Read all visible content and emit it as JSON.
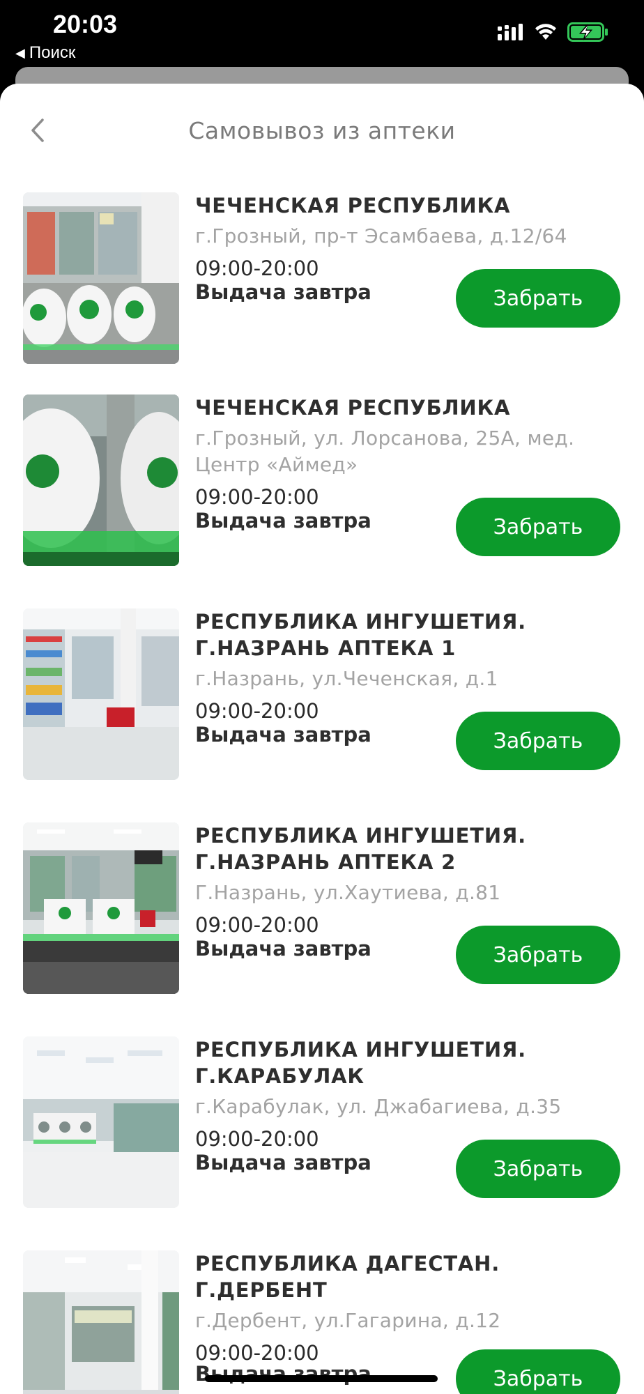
{
  "status_bar": {
    "time": "20:03",
    "back_app": "Поиск",
    "icons": [
      "cellular-signal-icon",
      "wifi-icon",
      "battery-charging-icon"
    ],
    "battery_color": "#34c759"
  },
  "header": {
    "title": "Самовывоз из аптеки",
    "back_icon": "chevron-left-icon"
  },
  "colors": {
    "accent": "#0c9a2b"
  },
  "pharmacies": [
    {
      "name": "ЧЕЧЕНСКАЯ РЕСПУБЛИКА",
      "address": "г.Грозный, пр-т Эсамбаева, д.12/64",
      "hours": "09:00-20:00",
      "delivery": "Выдача завтра",
      "button": "Забрать"
    },
    {
      "name": "ЧЕЧЕНСКАЯ РЕСПУБЛИКА",
      "address": "г.Грозный, ул. Лорсанова, 25А, мед. Центр «Аймед»",
      "hours": "09:00-20:00",
      "delivery": "Выдача завтра",
      "button": "Забрать"
    },
    {
      "name": "РЕСПУБЛИКА ИНГУШЕТИЯ. Г.НАЗРАНЬ АПТЕКА 1",
      "address": "г.Назрань, ул.Чеченская, д.1",
      "hours": "09:00-20:00",
      "delivery": "Выдача завтра",
      "button": "Забрать"
    },
    {
      "name": "РЕСПУБЛИКА ИНГУШЕТИЯ. Г.НАЗРАНЬ АПТЕКА 2",
      "address": "Г.Назрань, ул.Хаутиева, д.81",
      "hours": "09:00-20:00",
      "delivery": "Выдача завтра",
      "button": "Забрать"
    },
    {
      "name": "РЕСПУБЛИКА ИНГУШЕТИЯ. Г.КАРАБУЛАК",
      "address": "г.Карабулак, ул. Джабагиева, д.35",
      "hours": "09:00-20:00",
      "delivery": "Выдача завтра",
      "button": "Забрать"
    },
    {
      "name": "РЕСПУБЛИКА ДАГЕСТАН. Г.ДЕРБЕНТ",
      "address": "г.Дербент, ул.Гагарина, д.12",
      "hours": "09:00-20:00",
      "delivery": "Выдача завтра",
      "button": "Забрать"
    }
  ]
}
